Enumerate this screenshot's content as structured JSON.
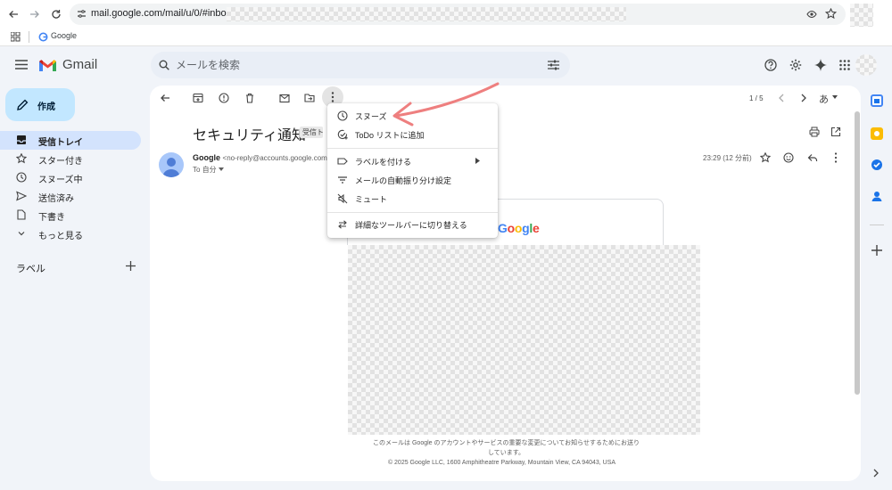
{
  "browser": {
    "url": "mail.google.com/mail/u/0/#inbox/F",
    "bookmark_label": "Google"
  },
  "header": {
    "logo_text": "Gmail",
    "search_placeholder": "メールを検索"
  },
  "sidebar": {
    "compose_label": "作成",
    "items": [
      {
        "label": "受信トレイ",
        "icon": "inbox-icon",
        "active": true
      },
      {
        "label": "スター付き",
        "icon": "star-icon"
      },
      {
        "label": "スヌーズ中",
        "icon": "clock-icon"
      },
      {
        "label": "送信済み",
        "icon": "send-icon"
      },
      {
        "label": "下書き",
        "icon": "draft-icon"
      },
      {
        "label": "もっと見る",
        "icon": "chevron-down-icon"
      }
    ],
    "labels_title": "ラベル"
  },
  "toolbar": {
    "pager": "1 / 5",
    "language_label": "あ"
  },
  "email": {
    "subject": "セキュリティ通知",
    "tag": "受信トレイ",
    "sender_name": "Google",
    "sender_email": "<no-reply@accounts.google.com>",
    "to": "To 自分",
    "timestamp": "23:29 (12 分前)",
    "body_logo": "Google",
    "footer_line1": "このメールは Google のアカウントやサービスの重要な変更についてお知らせするためにお送りしています。",
    "footer_line2": "© 2025 Google LLC, 1600 Amphitheatre Parkway, Mountain View, CA 94043, USA"
  },
  "menu": {
    "items": [
      {
        "label": "スヌーズ",
        "icon": "clock-icon"
      },
      {
        "label": "ToDo リストに追加",
        "icon": "add-task-icon"
      },
      {
        "label": "ラベルを付ける",
        "icon": "label-icon",
        "submenu": true
      },
      {
        "label": "メールの自動振り分け設定",
        "icon": "filter-icon"
      },
      {
        "label": "ミュート",
        "icon": "mute-icon"
      },
      {
        "label": "詳細なツールバーに切り替える",
        "icon": "swap-icon"
      }
    ]
  },
  "colors": {
    "accent": "#c2e7ff",
    "active_nav": "#d3e3fd",
    "annotation_arrow": "#ee7f7f"
  }
}
